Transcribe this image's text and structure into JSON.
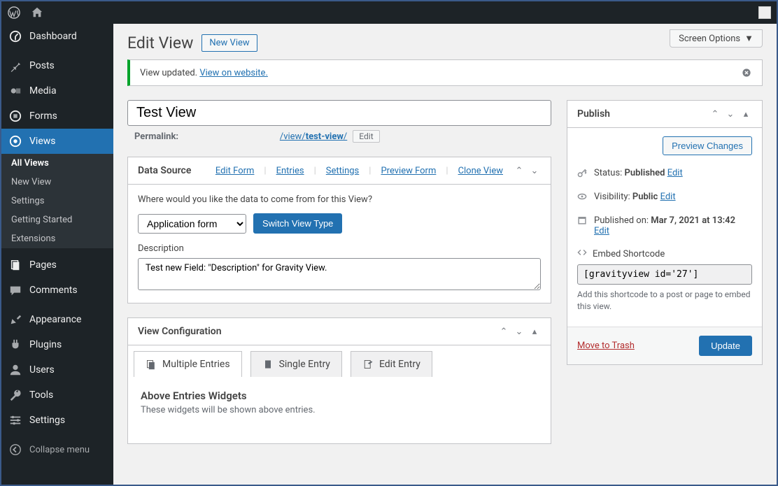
{
  "adminbar": {},
  "sidebar": {
    "items": [
      {
        "label": "Dashboard",
        "icon": "dashboard"
      },
      {
        "label": "Posts",
        "icon": "pin"
      },
      {
        "label": "Media",
        "icon": "media"
      },
      {
        "label": "Forms",
        "icon": "forms"
      },
      {
        "label": "Views",
        "icon": "views"
      },
      {
        "label": "Pages",
        "icon": "pages"
      },
      {
        "label": "Comments",
        "icon": "comments"
      },
      {
        "label": "Appearance",
        "icon": "appearance"
      },
      {
        "label": "Plugins",
        "icon": "plugins"
      },
      {
        "label": "Users",
        "icon": "users"
      },
      {
        "label": "Tools",
        "icon": "tools"
      },
      {
        "label": "Settings",
        "icon": "settings"
      }
    ],
    "views_submenu": [
      "All Views",
      "New View",
      "Settings",
      "Getting Started",
      "Extensions"
    ],
    "collapse_label": "Collapse menu"
  },
  "screen_options": "Screen Options",
  "page": {
    "title": "Edit View",
    "action": "New View"
  },
  "notice": {
    "text": "View updated. ",
    "link": "View on website."
  },
  "editor": {
    "title_value": "Test View",
    "permalink_label": "Permalink:",
    "permalink_path": "/view/",
    "permalink_slug": "test-view",
    "permalink_trail": "/",
    "edit_btn": "Edit"
  },
  "data_source": {
    "title": "Data Source",
    "links": [
      "Edit Form",
      "Entries",
      "Settings",
      "Preview Form",
      "Clone View"
    ],
    "question": "Where would you like the data to come from for this View?",
    "select_value": "Application form",
    "switch_btn": "Switch View Type",
    "desc_label": "Description",
    "desc_value": "Test new Field: \"Description\" for Gravity View."
  },
  "view_config": {
    "title": "View Configuration",
    "tabs": [
      "Multiple Entries",
      "Single Entry",
      "Edit Entry"
    ],
    "above_title": "Above Entries Widgets",
    "above_hint": "These widgets will be shown above entries."
  },
  "publish": {
    "title": "Publish",
    "preview_btn": "Preview Changes",
    "status_label": "Status: ",
    "status_value": "Published",
    "visibility_label": "Visibility: ",
    "visibility_value": "Public",
    "published_label": "Published on: ",
    "published_value": "Mar 7, 2021 at 13:42",
    "edit_link": "Edit",
    "shortcode_label": "Embed Shortcode",
    "shortcode_value": "[gravityview id='27']",
    "shortcode_hint": "Add this shortcode to a post or page to embed this view.",
    "trash": "Move to Trash",
    "update": "Update"
  }
}
